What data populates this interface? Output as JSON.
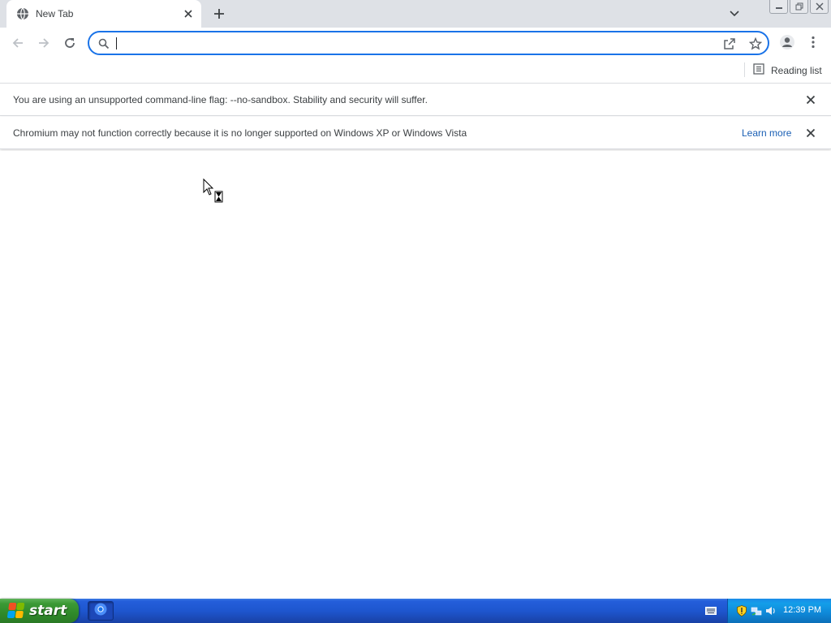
{
  "browser": {
    "tab": {
      "title": "New Tab"
    },
    "omnibox": {
      "value": "",
      "placeholder": ""
    },
    "bookmarks": {
      "reading_list_label": "Reading list"
    }
  },
  "infobars": [
    {
      "message": "You are using an unsupported command-line flag: --no-sandbox. Stability and security will suffer.",
      "link": ""
    },
    {
      "message": "Chromium may not function correctly because it is no longer supported on Windows XP or Windows Vista",
      "link": "Learn more"
    }
  ],
  "taskbar": {
    "start_label": "start",
    "clock": "12:39 PM",
    "running_apps": [
      "chromium-icon"
    ]
  },
  "colors": {
    "accent": "#1a73e8",
    "tabstrip": "#dee1e6",
    "link": "#1a5fb4",
    "taskbar_blue": "#245edb",
    "start_green": "#3c9a36"
  },
  "icons": {
    "tab": [
      "globe-icon",
      "close-icon",
      "plus-icon",
      "chevron-down-icon"
    ],
    "window": [
      "minimize-icon",
      "restore-icon",
      "close-icon"
    ],
    "toolbar": [
      "back-arrow-icon",
      "forward-arrow-icon",
      "reload-icon",
      "search-icon",
      "share-icon",
      "star-icon",
      "profile-icon",
      "kebab-menu-icon"
    ],
    "bookmarks": [
      "reading-list-icon"
    ],
    "tray": [
      "keyboard-icon",
      "shield-icon",
      "network-icon",
      "volume-icon"
    ],
    "cursor": "busy-pointer-icon"
  }
}
